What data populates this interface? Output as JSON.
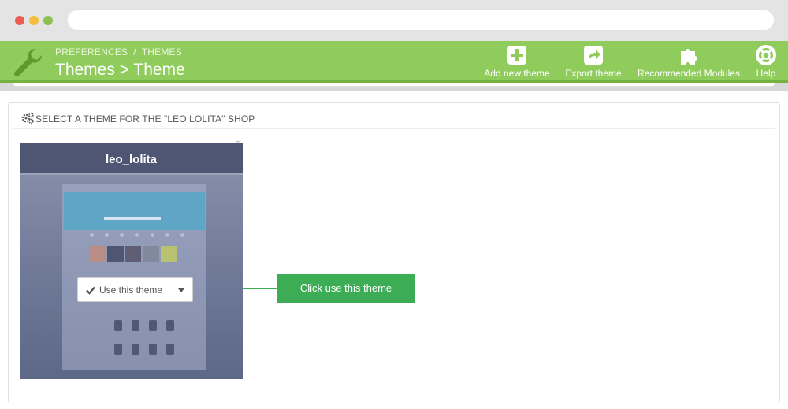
{
  "breadcrumb": {
    "item1": "PREFERENCES",
    "separator": "/",
    "item2": "THEMES"
  },
  "page_title": "Themes > Theme",
  "toolbar": {
    "add_label": "Add new theme",
    "export_label": "Export theme",
    "modules_label": "Recommended Modules",
    "help_label": "Help"
  },
  "panel": {
    "heading": "SELECT A THEME FOR THE \"LEO LOLITA\" SHOP"
  },
  "theme_card": {
    "name": "leo_lolita",
    "use_button_label": "Use this theme"
  },
  "callout": {
    "label": "Click use this theme"
  },
  "colors": {
    "header_green": "#8fcc5c",
    "callout_green": "#3cad55",
    "card_header": "#4e5674"
  },
  "icons": {
    "header": "wrench-icon",
    "add": "plus-square-icon",
    "export": "share-arrow-icon",
    "modules": "puzzle-icon",
    "help": "lifebuoy-icon",
    "panel": "gears-icon",
    "use": "check-icon"
  }
}
